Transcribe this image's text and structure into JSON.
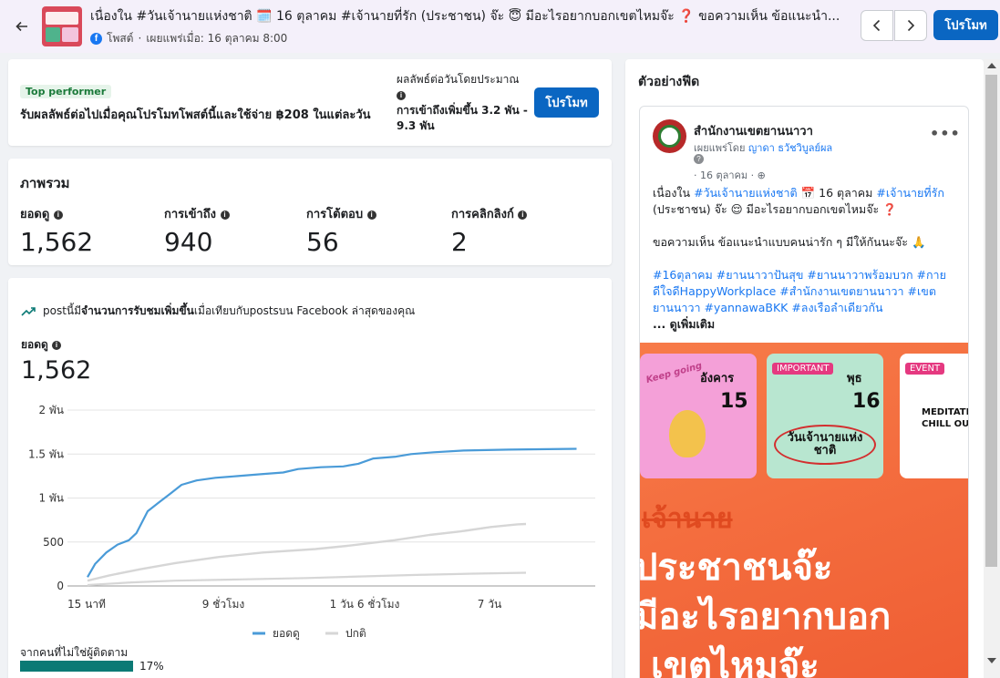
{
  "header": {
    "title": "เนื่องใน #วันเจ้านายแห่งชาติ 🗓️ 16 ตุลาคม #เจ้านายที่รัก (ประชาชน) จ๊ะ 😇 มีอะไรอยากบอกเขตไหมจ๊ะ ❓ ขอความเห็น ข้อแนะนำ...",
    "post_type": "โพสต์",
    "published": "เผยแพร่เมื่อ: 16 ตุลาคม 8:00",
    "promote_label": "โปรโมท"
  },
  "top_performer": {
    "badge": "Top performer",
    "text": "รับผลลัพธ์ต่อไปเมื่อคุณโปรโมทโพสต์นี้และใช้จ่าย ฿208 ในแต่ละวัน",
    "estimate_label": "ผลลัพธ์ต่อวันโดยประมาณ",
    "estimate_value": "การเข้าถึงเพิ่มขึ้น 3.2 พัน - 9.3 พัน",
    "promote_label": "โปรโมท"
  },
  "overview": {
    "title": "ภาพรวม",
    "metrics": [
      {
        "label": "ยอดดู",
        "value": "1,562"
      },
      {
        "label": "การเข้าถึง",
        "value": "940"
      },
      {
        "label": "การโต้ตอบ",
        "value": "56"
      },
      {
        "label": "การคลิกลิงก์",
        "value": "2"
      }
    ]
  },
  "chart_card": {
    "trend_prefix": "postนี้มี",
    "trend_bold": "จำนวนการรับชมเพิ่มขึ้น",
    "trend_suffix": "เมื่อเทียบกับpostsบน Facebook ล่าสุดของคุณ",
    "metric_label": "ยอดดู",
    "metric_value": "1,562",
    "non_follower_label": "จากคนที่ไม่ใช่ผู้ติดตาม",
    "non_follower_value": "17%",
    "non_follower_fraction": 0.17
  },
  "chart_data": {
    "type": "line",
    "y_ticks": [
      "0",
      "500",
      "1 พัน",
      "1.5 พัน",
      "2 พัน"
    ],
    "x_ticks": [
      "15 นาที",
      "9 ชั่วโมง",
      "1 วัน 6 ชั่วโมง",
      "7 วัน"
    ],
    "ylim": [
      0,
      2000
    ],
    "x_range": [
      0,
      100
    ],
    "legend": [
      "ยอดดู",
      "ปกติ"
    ],
    "legend_position": "bottom",
    "grid": true,
    "colors": {
      "views": "#4a9bd8",
      "normal": "#d6d6d6"
    },
    "series": [
      {
        "name": "ยอดดู",
        "points": [
          [
            0,
            100
          ],
          [
            2,
            250
          ],
          [
            5,
            380
          ],
          [
            8,
            470
          ],
          [
            11,
            520
          ],
          [
            13,
            600
          ],
          [
            16,
            850
          ],
          [
            19,
            950
          ],
          [
            22,
            1050
          ],
          [
            25,
            1150
          ],
          [
            29,
            1200
          ],
          [
            34,
            1230
          ],
          [
            40,
            1250
          ],
          [
            46,
            1270
          ],
          [
            52,
            1290
          ],
          [
            56,
            1330
          ],
          [
            62,
            1350
          ],
          [
            68,
            1360
          ],
          [
            72,
            1390
          ],
          [
            76,
            1450
          ],
          [
            82,
            1470
          ],
          [
            86,
            1500
          ],
          [
            92,
            1520
          ],
          [
            100,
            1540
          ],
          [
            112,
            1550
          ],
          [
            130,
            1560
          ]
        ]
      },
      {
        "name": "ปกติ",
        "points": [
          [
            0,
            60
          ],
          [
            5,
            120
          ],
          [
            12,
            190
          ],
          [
            20,
            260
          ],
          [
            30,
            330
          ],
          [
            40,
            380
          ],
          [
            52,
            420
          ],
          [
            60,
            460
          ],
          [
            70,
            520
          ],
          [
            78,
            580
          ],
          [
            85,
            620
          ],
          [
            92,
            670
          ],
          [
            98,
            700
          ],
          [
            100,
            705
          ]
        ]
      },
      {
        "name": "ปกติ",
        "points": [
          [
            0,
            10
          ],
          [
            10,
            40
          ],
          [
            20,
            60
          ],
          [
            35,
            75
          ],
          [
            50,
            90
          ],
          [
            60,
            105
          ],
          [
            75,
            125
          ],
          [
            88,
            140
          ],
          [
            100,
            150
          ]
        ]
      }
    ]
  },
  "feed": {
    "title": "ตัวอย่างฟีด",
    "page_name": "สำนักงานเขตยานนาวา",
    "posted_by_prefix": "เผยแพร่โดย",
    "posted_by_name": "ญาดา ธวัชวิบูลย์ผล",
    "date": "· 16 ตุลาคม ·",
    "body_line1_a": "เนื่องใน ",
    "body_tag1": "#วันเจ้านายแห่งชาติ",
    "body_line1_b": " 📅 16 ตุลาคม ",
    "body_tag2": "#เจ้านายที่รัก",
    "body_line1_c": " (ประชาชน) จ๊ะ 😌 มีอะไรอยากบอกเขตไหมจ๊ะ ❓",
    "body_line2": "ขอความเห็น ข้อแนะนำแบบคนน่ารัก ๆ มีให้กันนะจ๊ะ 🙏",
    "body_tags": "#16ตุลาคม #ยานนาวาปันสุข #ยานนาวาพร้อมบวก #กายดีใจดีHappyWorkplace #สำนักงานเขตยานนาวา #เขตยานนาวา #yannawaBKK #ลงเรือลำเดียวกัน",
    "see_more": "... ดูเพิ่มเติม",
    "image": {
      "tile1_sticker": "Keep going",
      "tile1_day": "อังคาร",
      "tile1_num": "15",
      "tile2_chip": "IMPORTANT",
      "tile2_day": "พุธ",
      "tile2_num": "16",
      "tile2_text": "วันเจ้านายแห่งชาติ",
      "tile3_chip": "EVENT",
      "tile3_text": "MEDITATE CHILL OUT",
      "line1": "เจ้านาย",
      "line2": "ประชาชนจ๊ะ",
      "line3": "มีอะไรอยากบอก",
      "line4": "เขตไหมจ๊ะ"
    }
  }
}
